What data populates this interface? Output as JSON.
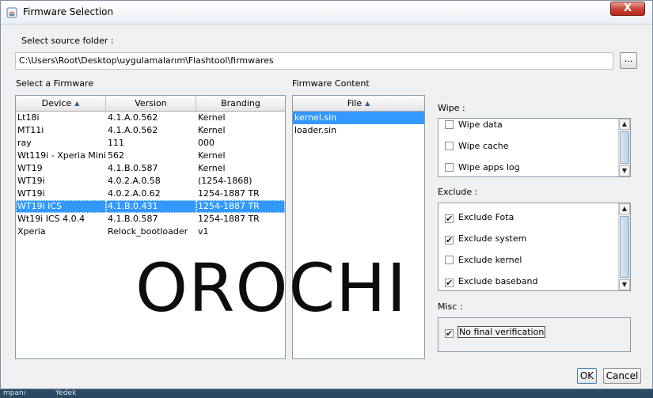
{
  "window": {
    "title": "Firmware Selection",
    "close_glyph": "X"
  },
  "source": {
    "label": "Select source folder :",
    "path": "C:\\Users\\Root\\Desktop\\uygulamalarım\\Flashtool\\firmwares",
    "browse_label": "..."
  },
  "firmware": {
    "label": "Select a Firmware",
    "columns": {
      "device": "Device",
      "version": "Version",
      "branding": "Branding"
    },
    "rows": [
      {
        "device": "Lt18i",
        "version": "4.1.A.0.562",
        "branding": "Kernel"
      },
      {
        "device": "MT11i",
        "version": "4.1.A.0.562",
        "branding": "Kernel"
      },
      {
        "device": "ray",
        "version": "111",
        "branding": "000"
      },
      {
        "device": "Wt119i - Xperia Mini",
        "version": "562",
        "branding": "Kernel"
      },
      {
        "device": "WT19",
        "version": "4.1.B.0.587",
        "branding": "Kernel"
      },
      {
        "device": "WT19i",
        "version": "4.0.2.A.0.58",
        "branding": "(1254-1868)"
      },
      {
        "device": "WT19i",
        "version": "4.0.2.A.0.62",
        "branding": "1254-1887 TR"
      },
      {
        "device": "WT19i ICS",
        "version": "4.1.B.0.431",
        "branding": "1254-1887 TR"
      },
      {
        "device": "Wt19i ICS 4.0.4",
        "version": "4.1.B.0.587",
        "branding": "1254-1887 TR"
      },
      {
        "device": "Xperia",
        "version": "Relock_bootloader",
        "branding": "v1"
      }
    ]
  },
  "content": {
    "label": "Firmware Content",
    "column": "File",
    "files": [
      "kernel.sin",
      "loader.sin"
    ]
  },
  "wipe": {
    "label": "Wipe :",
    "items": [
      {
        "label": "Wipe data",
        "checked": false
      },
      {
        "label": "Wipe cache",
        "checked": false
      },
      {
        "label": "Wipe apps log",
        "checked": false
      }
    ]
  },
  "exclude": {
    "label": "Exclude :",
    "items": [
      {
        "label": "Exclude Fota",
        "checked": true
      },
      {
        "label": "Exclude system",
        "checked": true
      },
      {
        "label": "Exclude kernel",
        "checked": false
      },
      {
        "label": "Exclude baseband",
        "checked": true
      }
    ]
  },
  "misc": {
    "label": "Misc :",
    "items": [
      {
        "label": "No final verification",
        "checked": true
      }
    ]
  },
  "buttons": {
    "ok": "OK",
    "cancel": "Cancel"
  },
  "watermark": "OROCHI",
  "taskbar": {
    "items": [
      "mpanı",
      "Yedek"
    ]
  },
  "glyphs": {
    "check": "✔",
    "sort_up": "▲",
    "arrow_up": "▲",
    "arrow_down": "▼"
  },
  "colors": {
    "selection": "#3399ff",
    "window_bg": "#f0f0f0",
    "close_button": "#c7483b"
  }
}
